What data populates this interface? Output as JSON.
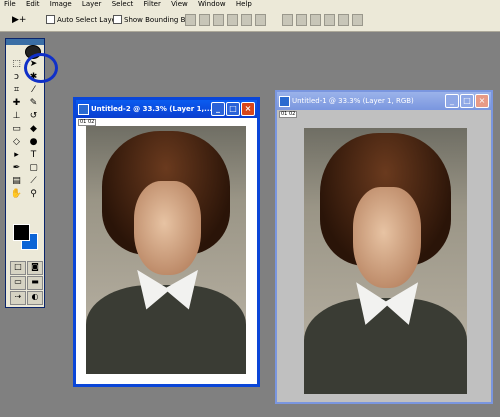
{
  "menu": [
    "File",
    "Edit",
    "Image",
    "Layer",
    "Select",
    "Filter",
    "View",
    "Window",
    "Help"
  ],
  "options": {
    "tool_glyph": "▶+",
    "auto_select_label": "Auto Select Layer",
    "bounding_box_label": "Show Bounding Box"
  },
  "docs": [
    {
      "title": "Untitled-2 @ 33.3% (Layer 1,...",
      "ruler": "01 02"
    },
    {
      "title": "Untitled-1 @ 33.3% (Layer 1, RGB)",
      "ruler": "01 02"
    }
  ],
  "colors": {
    "foreground": "#000000",
    "background": "#0b64d6",
    "highlight": "#1030c8"
  }
}
